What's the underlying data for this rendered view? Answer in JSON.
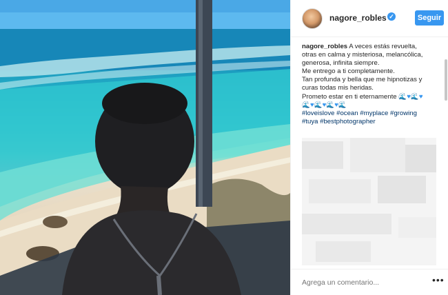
{
  "post": {
    "username": "nagore_robles",
    "verified_icon": "verified-badge-icon",
    "follow_label": "Seguir",
    "caption_lines": [
      "A veces estás revuelta,",
      "otras en calma y misteriosa, melancólica,",
      "generosa, infinita siempre.",
      "Me entrego a ti completamente.",
      "Tan profunda y bella que me hipnotizas y",
      "curas todas mis heridas.",
      "Prometo estar en ti eternamente"
    ],
    "emoji_line_1": "🌊♥🌊♥",
    "emoji_line_2": "🌊♥🌊♥🌊♥🌊",
    "hashtags_line_1": "#loveislove #ocean #myplace #growing",
    "hashtags_line_2": "#tuya #bestphotographer"
  },
  "comment": {
    "placeholder": "Agrega un comentario...",
    "more_label": "•••"
  },
  "photo": {
    "description_icon": "beach-photo"
  },
  "colors": {
    "accent": "#3897f0",
    "hashtag": "#003569",
    "text": "#262626"
  }
}
